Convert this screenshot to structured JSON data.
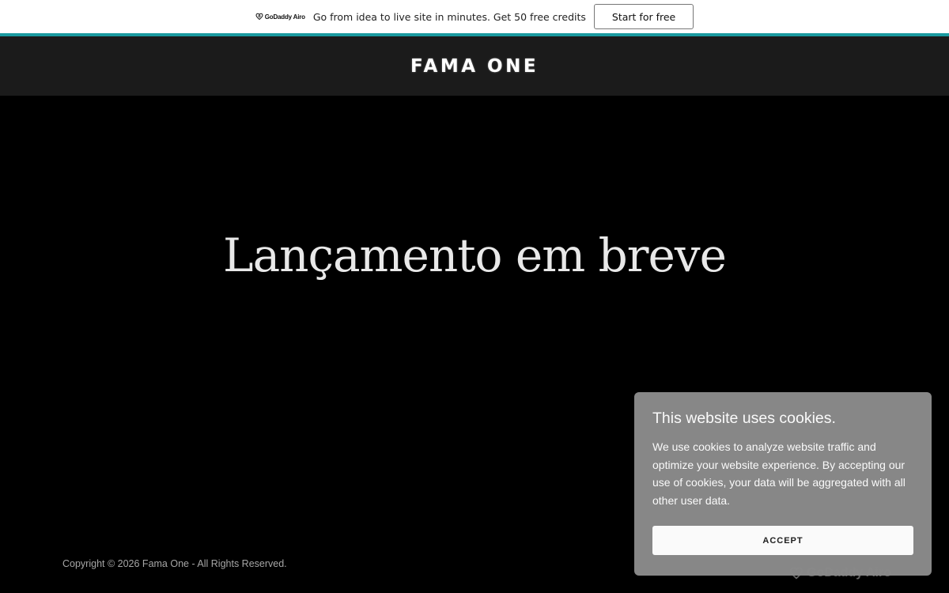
{
  "promo": {
    "logo_text": "GoDaddy Airo",
    "message": "Go from idea to live site in minutes. Get 50 free credits",
    "cta_label": "Start for free",
    "stripe_color": "#1a9aa0"
  },
  "header": {
    "site_title": "FAMA ONE"
  },
  "hero": {
    "heading": "Lançamento em breve"
  },
  "footer": {
    "copyright": "Copyright © 2026 Fama One - All Rights Reserved.",
    "brand": "GoDaddy Airo"
  },
  "cookie_banner": {
    "title": "This website uses cookies.",
    "body": "We use cookies to analyze website traffic and optimize your website experience. By accepting our use of cookies, your data will be aggregated with all other user data.",
    "accept_label": "ACCEPT"
  },
  "icons": {
    "promo_logo": "godaddy-heart-icon",
    "footer_logo": "godaddy-heart-icon"
  }
}
